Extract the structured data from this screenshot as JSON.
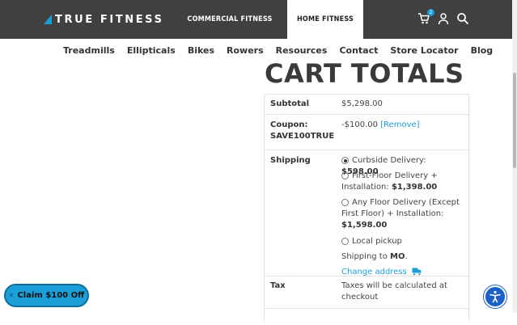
{
  "header": {
    "brand": "TRUE FITNESS",
    "nav": {
      "commercial": "COMMERCIAL FITNESS",
      "home": "HOME FITNESS"
    },
    "cart_count": "2",
    "icons": [
      "cart-icon",
      "account-icon",
      "search-icon"
    ]
  },
  "subnav": [
    "Treadmills",
    "Ellipticals",
    "Bikes",
    "Rowers",
    "Resources",
    "Contact",
    "Store Locator",
    "Blog"
  ],
  "cart": {
    "title": "CART TOTALS",
    "subtotal_label": "Subtotal",
    "subtotal_value": "$5,298.00",
    "coupon_label_1": "Coupon:",
    "coupon_label_2": "SAVE100TRUE",
    "coupon_value": "-$100.00",
    "coupon_remove": "[Remove]",
    "shipping_label": "Shipping",
    "shipping_options": [
      {
        "label": "Curbside Delivery: ",
        "price": "$598.00",
        "selected": true
      },
      {
        "label": "First-Floor Delivery + Installation: ",
        "price": "$1,398.00",
        "selected": false
      },
      {
        "label": "Any Floor Delivery (Except First Floor) + Installation: ",
        "price": "$1,598.00",
        "selected": false
      },
      {
        "label": "Local pickup",
        "price": "",
        "selected": false
      }
    ],
    "shipping_to_prefix": "Shipping to ",
    "shipping_to_state": "MO",
    "shipping_to_suffix": ".",
    "change_address": "Change address",
    "tax_label": "Tax",
    "tax_value": "Taxes will be calculated at checkout"
  },
  "promo": {
    "claim_label": "Claim $100 Off"
  },
  "colors": {
    "header_bg": "#404040",
    "accent": "#1a9fd8",
    "a11y": "#1b5fc9"
  }
}
